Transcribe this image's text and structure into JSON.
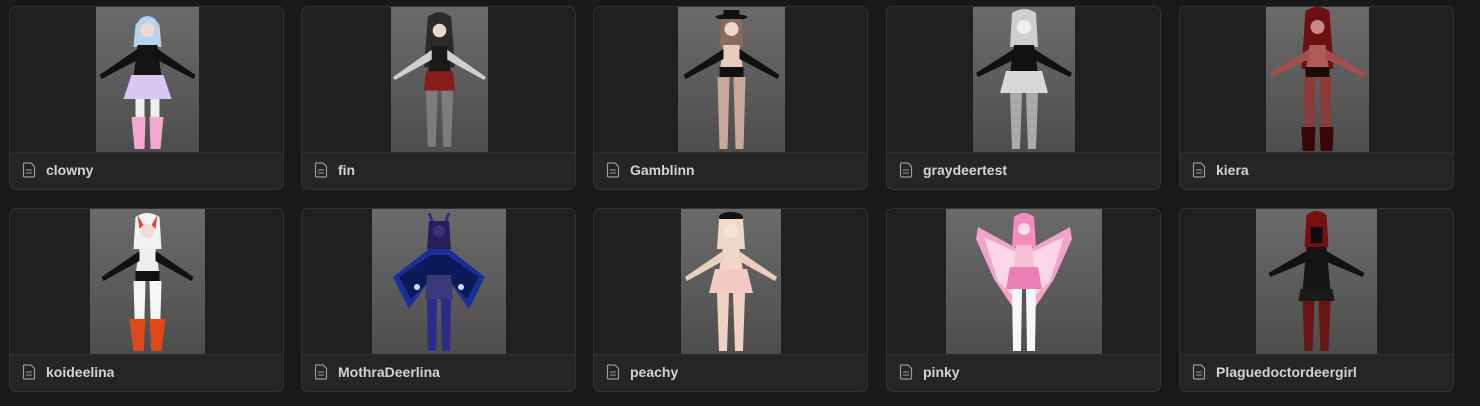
{
  "gallery": {
    "cards": [
      {
        "title": "clowny",
        "preview": "clowny avatar preview"
      },
      {
        "title": "fin",
        "preview": "fin avatar preview"
      },
      {
        "title": "Gamblinn",
        "preview": "Gamblinn avatar preview"
      },
      {
        "title": "graydeertest",
        "preview": "graydeertest avatar preview"
      },
      {
        "title": "kiera",
        "preview": "kiera avatar preview"
      },
      {
        "title": "koideelina",
        "preview": "koideelina avatar preview"
      },
      {
        "title": "MothraDeerlina",
        "preview": "MothraDeerlina avatar preview"
      },
      {
        "title": "peachy",
        "preview": "peachy avatar preview"
      },
      {
        "title": "pinky",
        "preview": "pinky avatar preview"
      },
      {
        "title": "Plaguedoctordeergirl",
        "preview": "Plaguedoctordeergirl avatar preview"
      }
    ]
  },
  "icons": {
    "page": "page-icon"
  },
  "colors": {
    "background": "#191919",
    "card": "#252525",
    "text": "#d4d4d4"
  }
}
